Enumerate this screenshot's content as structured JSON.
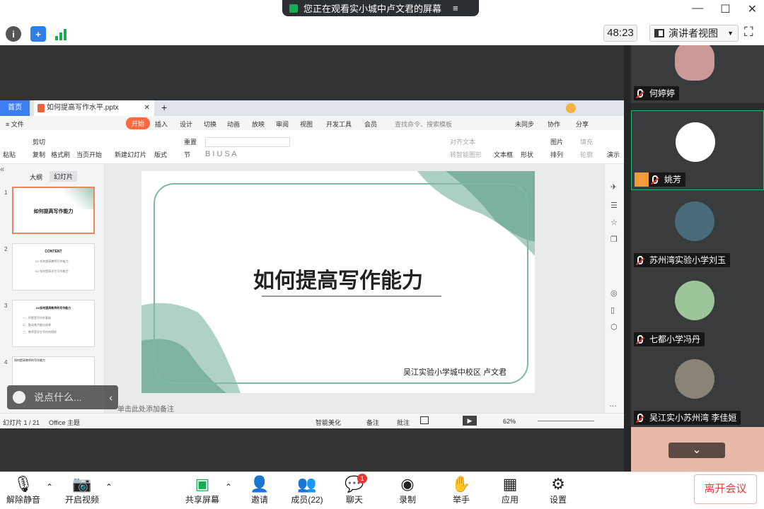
{
  "banner": {
    "text": "您正在观看实小城中卢文君的屏幕",
    "menu_icon": "≡"
  },
  "window": {
    "min": "—",
    "max": "☐",
    "close": "✕"
  },
  "toolbar": {
    "timer": "48:23",
    "view_label": "演讲者视图",
    "view_arrow": "▼",
    "fullscreen": "⛶"
  },
  "wps": {
    "home_tab": "首页",
    "doc_tab": "如何提高写作水平.pptx",
    "tab_close": "✕",
    "tab_add": "+",
    "menu": {
      "file": "≡ 文件",
      "start": "开始",
      "insert": "插入",
      "design": "设计",
      "switch": "切换",
      "anim": "动画",
      "show": "放映",
      "review": "审阅",
      "view": "视图",
      "dev": "开发工具",
      "member": "会员",
      "search": "查找命令、搜索模板",
      "sync": "未同步",
      "collab": "协作",
      "share": "分享"
    },
    "ribbon": {
      "paste": "粘贴",
      "cut": "剪切",
      "copy": "复制",
      "format_painter": "格式刷",
      "play_from": "当页开始",
      "new_slide": "新建幻灯片",
      "layout": "版式",
      "reset": "重置",
      "section": "节",
      "align": "对齐文本",
      "smart": "转智能图形",
      "textbox": "文本框",
      "shape": "形状",
      "picture": "图片",
      "fill": "填充",
      "arrange": "排列",
      "outline": "轮廓",
      "present": "演示"
    },
    "panel": {
      "outline": "大纲",
      "slides": "幻灯片"
    },
    "thumbs": [
      {
        "num": "1",
        "title": "如何提高写作能力"
      },
      {
        "num": "2",
        "title": "CONTENT",
        "l1": "01/ 如何提高教师写作能力",
        "l2": "02/ 如何提高学生写作能力"
      },
      {
        "num": "3",
        "title": "01/如何提高教师的写作能力",
        "l1": "一、积累是写作的基础",
        "l2": "二、勤动笔才能出成果",
        "l3": "三、教师是学生写作的榜样"
      },
      {
        "num": "4",
        "title": "如何提高教师的写作能力"
      }
    ],
    "slide": {
      "title": "如何提高写作能力",
      "author": "吴江实验小学城中校区 卢文君"
    },
    "notes_hint": "单击此处添加备注",
    "status": {
      "slide_count": "幻灯片 1 / 21",
      "theme": "Office 主题",
      "beautify": "智能美化",
      "notes": "备注",
      "comments": "批注",
      "zoom": "62%"
    }
  },
  "comment_box": {
    "placeholder": "说点什么..."
  },
  "participants": [
    {
      "name": "何婷婷"
    },
    {
      "name": "姚芳"
    },
    {
      "name": "苏州湾实验小学刘玉"
    },
    {
      "name": "七都小学冯丹"
    },
    {
      "name": "吴江实小苏州湾 李佳姮"
    }
  ],
  "bottom": {
    "mute": "解除静音",
    "video": "开启视频",
    "share": "共享屏幕",
    "invite": "邀请",
    "members": "成员(22)",
    "chat": "聊天",
    "chat_badge": "1",
    "record": "录制",
    "raise": "举手",
    "apps": "应用",
    "settings": "设置",
    "leave": "离开会议"
  },
  "colors": {
    "accent": "#3b7ff2",
    "danger": "#e23b3b",
    "green": "#1aab55",
    "slide_green": "#7fb9a4"
  }
}
